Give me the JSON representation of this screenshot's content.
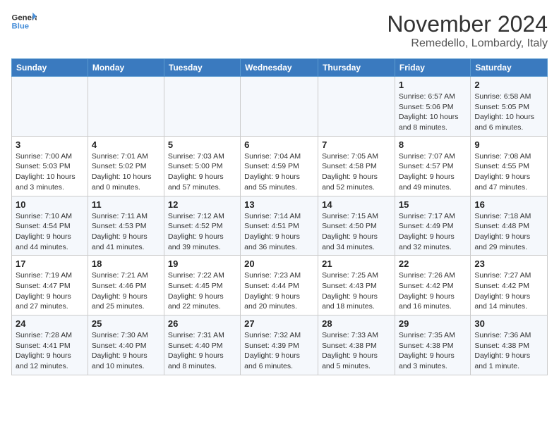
{
  "logo": {
    "text_general": "General",
    "text_blue": "Blue"
  },
  "header": {
    "month": "November 2024",
    "location": "Remedello, Lombardy, Italy"
  },
  "weekdays": [
    "Sunday",
    "Monday",
    "Tuesday",
    "Wednesday",
    "Thursday",
    "Friday",
    "Saturday"
  ],
  "weeks": [
    [
      {
        "day": "",
        "info": ""
      },
      {
        "day": "",
        "info": ""
      },
      {
        "day": "",
        "info": ""
      },
      {
        "day": "",
        "info": ""
      },
      {
        "day": "",
        "info": ""
      },
      {
        "day": "1",
        "info": "Sunrise: 6:57 AM\nSunset: 5:06 PM\nDaylight: 10 hours and 8 minutes."
      },
      {
        "day": "2",
        "info": "Sunrise: 6:58 AM\nSunset: 5:05 PM\nDaylight: 10 hours and 6 minutes."
      }
    ],
    [
      {
        "day": "3",
        "info": "Sunrise: 7:00 AM\nSunset: 5:03 PM\nDaylight: 10 hours and 3 minutes."
      },
      {
        "day": "4",
        "info": "Sunrise: 7:01 AM\nSunset: 5:02 PM\nDaylight: 10 hours and 0 minutes."
      },
      {
        "day": "5",
        "info": "Sunrise: 7:03 AM\nSunset: 5:00 PM\nDaylight: 9 hours and 57 minutes."
      },
      {
        "day": "6",
        "info": "Sunrise: 7:04 AM\nSunset: 4:59 PM\nDaylight: 9 hours and 55 minutes."
      },
      {
        "day": "7",
        "info": "Sunrise: 7:05 AM\nSunset: 4:58 PM\nDaylight: 9 hours and 52 minutes."
      },
      {
        "day": "8",
        "info": "Sunrise: 7:07 AM\nSunset: 4:57 PM\nDaylight: 9 hours and 49 minutes."
      },
      {
        "day": "9",
        "info": "Sunrise: 7:08 AM\nSunset: 4:55 PM\nDaylight: 9 hours and 47 minutes."
      }
    ],
    [
      {
        "day": "10",
        "info": "Sunrise: 7:10 AM\nSunset: 4:54 PM\nDaylight: 9 hours and 44 minutes."
      },
      {
        "day": "11",
        "info": "Sunrise: 7:11 AM\nSunset: 4:53 PM\nDaylight: 9 hours and 41 minutes."
      },
      {
        "day": "12",
        "info": "Sunrise: 7:12 AM\nSunset: 4:52 PM\nDaylight: 9 hours and 39 minutes."
      },
      {
        "day": "13",
        "info": "Sunrise: 7:14 AM\nSunset: 4:51 PM\nDaylight: 9 hours and 36 minutes."
      },
      {
        "day": "14",
        "info": "Sunrise: 7:15 AM\nSunset: 4:50 PM\nDaylight: 9 hours and 34 minutes."
      },
      {
        "day": "15",
        "info": "Sunrise: 7:17 AM\nSunset: 4:49 PM\nDaylight: 9 hours and 32 minutes."
      },
      {
        "day": "16",
        "info": "Sunrise: 7:18 AM\nSunset: 4:48 PM\nDaylight: 9 hours and 29 minutes."
      }
    ],
    [
      {
        "day": "17",
        "info": "Sunrise: 7:19 AM\nSunset: 4:47 PM\nDaylight: 9 hours and 27 minutes."
      },
      {
        "day": "18",
        "info": "Sunrise: 7:21 AM\nSunset: 4:46 PM\nDaylight: 9 hours and 25 minutes."
      },
      {
        "day": "19",
        "info": "Sunrise: 7:22 AM\nSunset: 4:45 PM\nDaylight: 9 hours and 22 minutes."
      },
      {
        "day": "20",
        "info": "Sunrise: 7:23 AM\nSunset: 4:44 PM\nDaylight: 9 hours and 20 minutes."
      },
      {
        "day": "21",
        "info": "Sunrise: 7:25 AM\nSunset: 4:43 PM\nDaylight: 9 hours and 18 minutes."
      },
      {
        "day": "22",
        "info": "Sunrise: 7:26 AM\nSunset: 4:42 PM\nDaylight: 9 hours and 16 minutes."
      },
      {
        "day": "23",
        "info": "Sunrise: 7:27 AM\nSunset: 4:42 PM\nDaylight: 9 hours and 14 minutes."
      }
    ],
    [
      {
        "day": "24",
        "info": "Sunrise: 7:28 AM\nSunset: 4:41 PM\nDaylight: 9 hours and 12 minutes."
      },
      {
        "day": "25",
        "info": "Sunrise: 7:30 AM\nSunset: 4:40 PM\nDaylight: 9 hours and 10 minutes."
      },
      {
        "day": "26",
        "info": "Sunrise: 7:31 AM\nSunset: 4:40 PM\nDaylight: 9 hours and 8 minutes."
      },
      {
        "day": "27",
        "info": "Sunrise: 7:32 AM\nSunset: 4:39 PM\nDaylight: 9 hours and 6 minutes."
      },
      {
        "day": "28",
        "info": "Sunrise: 7:33 AM\nSunset: 4:38 PM\nDaylight: 9 hours and 5 minutes."
      },
      {
        "day": "29",
        "info": "Sunrise: 7:35 AM\nSunset: 4:38 PM\nDaylight: 9 hours and 3 minutes."
      },
      {
        "day": "30",
        "info": "Sunrise: 7:36 AM\nSunset: 4:38 PM\nDaylight: 9 hours and 1 minute."
      }
    ]
  ]
}
